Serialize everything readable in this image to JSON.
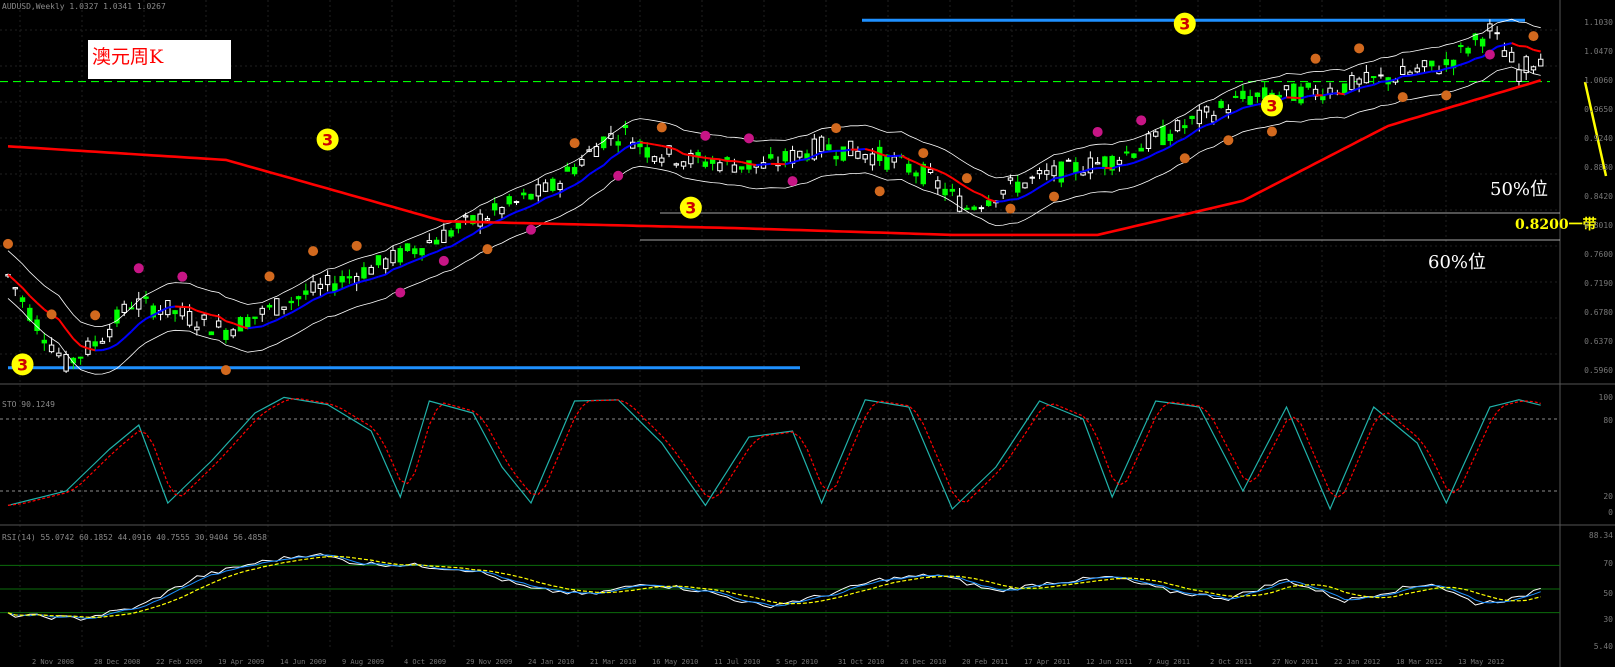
{
  "window": {
    "main_header": "AUDUSD,Weekly 1.0327 1.0341 1.0267",
    "stoch_header": "STO 90.1249",
    "rsi_header": "RSI(14) 55.0742 60.1852 44.0916 40.7555 30.9404 56.4858"
  },
  "title": "澳元周K",
  "annotations": {
    "fifty": "50%位",
    "level": "0.8200一带",
    "sixty": "60%位"
  },
  "price_axis": [
    "1.1030",
    "1.0470",
    "1.0060",
    "0.9650",
    "0.9240",
    "0.8830",
    "0.8420",
    "0.8010",
    "0.7600",
    "0.7190",
    "0.6780",
    "0.6370",
    "0.5960"
  ],
  "stoch_axis": [
    "100",
    "80",
    "20",
    "0"
  ],
  "rsi_axis": [
    "88.34",
    "70",
    "50",
    "30",
    "5.40"
  ],
  "x_labels": [
    "2 Nov 2008",
    "28 Dec 2008",
    "22 Feb 2009",
    "19 Apr 2009",
    "14 Jun 2009",
    "9 Aug 2009",
    "4 Oct 2009",
    "29 Nov 2009",
    "24 Jan 2010",
    "21 Mar 2010",
    "16 May 2010",
    "11 Jul 2010",
    "5 Sep 2010",
    "31 Oct 2010",
    "26 Dec 2010",
    "20 Feb 2011",
    "17 Apr 2011",
    "12 Jun 2011",
    "7 Aug 2011",
    "2 Oct 2011",
    "27 Nov 2011",
    "22 Jan 2012",
    "18 Mar 2012",
    "13 May 2012"
  ],
  "colors": {
    "background": "#000000",
    "bull_candle": "#ffffff",
    "bear_candle": "#00ff00",
    "ma_red": "#ff0000",
    "ma_blue": "#0000ff",
    "envelope": "#ffffff",
    "support_line": "#1e90ff",
    "dash_level": "#00ff00",
    "stoch_main": "#20b2aa",
    "stoch_signal": "#ff0000",
    "rsi_fast": "#ffffff",
    "rsi_mid": "#1e90ff",
    "rsi_slow": "#ffff00",
    "projection": "#ffff00"
  },
  "chart_data": {
    "type": "candlestick",
    "symbol": "AUDUSD Weekly",
    "title": "澳元周K",
    "ylim": [
      0.58,
      1.12
    ],
    "n_bars": 212,
    "price_waypoints": [
      [
        0,
        0.73
      ],
      [
        4,
        0.66
      ],
      [
        8,
        0.6
      ],
      [
        12,
        0.63
      ],
      [
        17,
        0.69
      ],
      [
        22,
        0.68
      ],
      [
        30,
        0.65
      ],
      [
        38,
        0.69
      ],
      [
        52,
        0.75
      ],
      [
        62,
        0.8
      ],
      [
        75,
        0.86
      ],
      [
        82,
        0.93
      ],
      [
        85,
        0.94
      ],
      [
        88,
        0.915
      ],
      [
        94,
        0.9
      ],
      [
        104,
        0.89
      ],
      [
        112,
        0.92
      ],
      [
        120,
        0.905
      ],
      [
        126,
        0.88
      ],
      [
        132,
        0.83
      ],
      [
        138,
        0.86
      ],
      [
        144,
        0.88
      ],
      [
        152,
        0.9
      ],
      [
        160,
        0.94
      ],
      [
        170,
        0.99
      ],
      [
        180,
        1.0
      ],
      [
        190,
        1.02
      ],
      [
        198,
        1.04
      ],
      [
        204,
        1.09
      ],
      [
        208,
        1.03
      ],
      [
        212,
        1.06
      ]
    ],
    "ma_red_long_waypoints": [
      [
        0,
        0.92
      ],
      [
        30,
        0.9
      ],
      [
        60,
        0.81
      ],
      [
        100,
        0.8
      ],
      [
        130,
        0.79
      ],
      [
        150,
        0.79
      ],
      [
        170,
        0.84
      ],
      [
        190,
        0.95
      ],
      [
        212,
        1.02
      ]
    ],
    "stoch_waypoints": [
      [
        0,
        8
      ],
      [
        8,
        20
      ],
      [
        14,
        55
      ],
      [
        18,
        75
      ],
      [
        22,
        10
      ],
      [
        28,
        45
      ],
      [
        34,
        85
      ],
      [
        38,
        98
      ],
      [
        44,
        92
      ],
      [
        50,
        70
      ],
      [
        54,
        15
      ],
      [
        58,
        95
      ],
      [
        64,
        85
      ],
      [
        68,
        40
      ],
      [
        72,
        10
      ],
      [
        78,
        95
      ],
      [
        84,
        96
      ],
      [
        90,
        60
      ],
      [
        96,
        8
      ],
      [
        102,
        65
      ],
      [
        108,
        70
      ],
      [
        112,
        10
      ],
      [
        118,
        96
      ],
      [
        124,
        90
      ],
      [
        130,
        5
      ],
      [
        136,
        40
      ],
      [
        142,
        95
      ],
      [
        148,
        80
      ],
      [
        152,
        15
      ],
      [
        158,
        95
      ],
      [
        164,
        90
      ],
      [
        170,
        20
      ],
      [
        176,
        90
      ],
      [
        182,
        5
      ],
      [
        188,
        90
      ],
      [
        194,
        60
      ],
      [
        198,
        10
      ],
      [
        204,
        90
      ],
      [
        208,
        96
      ],
      [
        212,
        90
      ]
    ],
    "rsi_waypoints": [
      [
        0,
        28
      ],
      [
        10,
        25
      ],
      [
        18,
        35
      ],
      [
        26,
        60
      ],
      [
        34,
        72
      ],
      [
        42,
        80
      ],
      [
        48,
        72
      ],
      [
        56,
        70
      ],
      [
        64,
        66
      ],
      [
        72,
        50
      ],
      [
        80,
        45
      ],
      [
        88,
        55
      ],
      [
        96,
        48
      ],
      [
        104,
        35
      ],
      [
        112,
        44
      ],
      [
        120,
        58
      ],
      [
        128,
        62
      ],
      [
        136,
        48
      ],
      [
        144,
        56
      ],
      [
        152,
        60
      ],
      [
        160,
        48
      ],
      [
        168,
        42
      ],
      [
        176,
        58
      ],
      [
        184,
        40
      ],
      [
        190,
        48
      ],
      [
        196,
        55
      ],
      [
        202,
        38
      ],
      [
        208,
        42
      ],
      [
        212,
        55
      ]
    ],
    "support_lines": [
      {
        "label": "bottom",
        "price": 0.595
      },
      {
        "label": "top",
        "price": 1.105
      }
    ],
    "levels": [
      {
        "label": "50%位",
        "price": 0.83
      },
      {
        "label": "0.8200一带",
        "price": 0.82
      },
      {
        "label": "60%位",
        "price": 0.805
      }
    ],
    "dash_level_price": 1.015,
    "markers": [
      {
        "bar": 2,
        "price": 0.6,
        "text": "3",
        "kind": "big"
      },
      {
        "bar": 44,
        "price": 0.93,
        "text": "3",
        "kind": "big"
      },
      {
        "bar": 94,
        "price": 0.83,
        "text": "3",
        "kind": "big"
      },
      {
        "bar": 162,
        "price": 1.1,
        "text": "3",
        "kind": "big"
      },
      {
        "bar": 174,
        "price": 0.98,
        "text": "3",
        "kind": "big"
      }
    ],
    "grid": true,
    "legend": "none"
  }
}
